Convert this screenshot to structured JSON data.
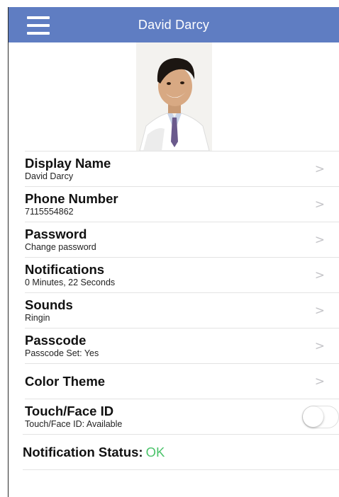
{
  "header": {
    "title": "David Darcy",
    "menu_icon": "hamburger-menu-icon",
    "background": "#5f7dc2"
  },
  "profile": {
    "avatar_icon": "profile-photo"
  },
  "settings": [
    {
      "title": "Display Name",
      "subtitle": "David Darcy",
      "accessory": "chevron-right-icon"
    },
    {
      "title": "Phone Number",
      "subtitle": "7115554862",
      "accessory": "chevron-right-icon"
    },
    {
      "title": "Password",
      "subtitle": "Change password",
      "accessory": "chevron-right-icon"
    },
    {
      "title": "Notifications",
      "subtitle": "0 Minutes, 22 Seconds",
      "accessory": "chevron-right-icon"
    },
    {
      "title": "Sounds",
      "subtitle": "Ringin",
      "accessory": "chevron-right-icon"
    },
    {
      "title": "Passcode",
      "subtitle": "Passcode Set: Yes",
      "accessory": "chevron-right-icon"
    },
    {
      "title": "Color Theme",
      "subtitle": "",
      "accessory": "chevron-right-icon"
    },
    {
      "title": "Touch/Face ID",
      "subtitle": "Touch/Face ID: Available",
      "accessory": "toggle",
      "toggle_on": false
    }
  ],
  "chevron_glyph": ">",
  "status": {
    "label": "Notification Status:",
    "value": "OK",
    "value_color": "#4cc36b"
  }
}
